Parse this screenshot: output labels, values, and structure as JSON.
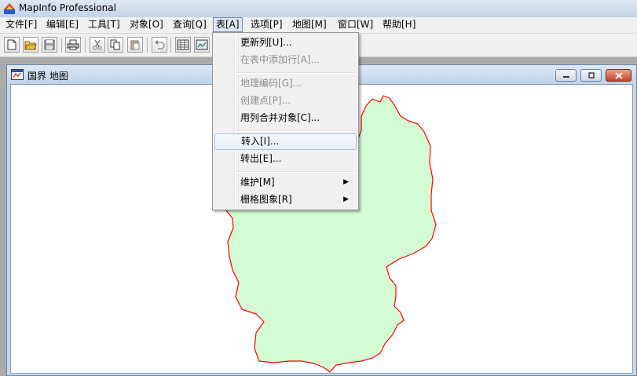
{
  "app": {
    "title": "MapInfo Professional"
  },
  "menubar": {
    "items": [
      {
        "label": "文件[F]"
      },
      {
        "label": "编辑[E]"
      },
      {
        "label": "工具[T]"
      },
      {
        "label": "对象[O]"
      },
      {
        "label": "查询[Q]"
      },
      {
        "label": "表[A]",
        "active": true
      },
      {
        "label": "选项[P]"
      },
      {
        "label": "地图[M]"
      },
      {
        "label": "窗口[W]"
      },
      {
        "label": "帮助[H]"
      }
    ]
  },
  "toolbar": {
    "icons": [
      "new-file-icon",
      "open-folder-icon",
      "save-icon",
      "print-icon",
      "cut-icon",
      "copy-icon",
      "paste-icon",
      "undo-icon",
      "browser-icon",
      "new-map-icon"
    ]
  },
  "document": {
    "title": "国界 地图",
    "map": {
      "fill_color": "#d4fcd4",
      "border_color": "#ff0000"
    }
  },
  "table_menu": {
    "items": [
      {
        "label": "更新列[U]...",
        "enabled": true
      },
      {
        "label": "在表中添加行[A]...",
        "enabled": false
      },
      {
        "label": "地理编码[G]...",
        "enabled": false
      },
      {
        "label": "创建点[P]...",
        "enabled": false
      },
      {
        "label": "用列合并对象[C]...",
        "enabled": true
      },
      {
        "label": "转入[I]...",
        "enabled": true,
        "hover": true
      },
      {
        "label": "转出[E]...",
        "enabled": true
      },
      {
        "label": "维护[M]",
        "enabled": true,
        "submenu": true
      },
      {
        "label": "栅格图象[R]",
        "enabled": true,
        "submenu": true
      }
    ]
  }
}
